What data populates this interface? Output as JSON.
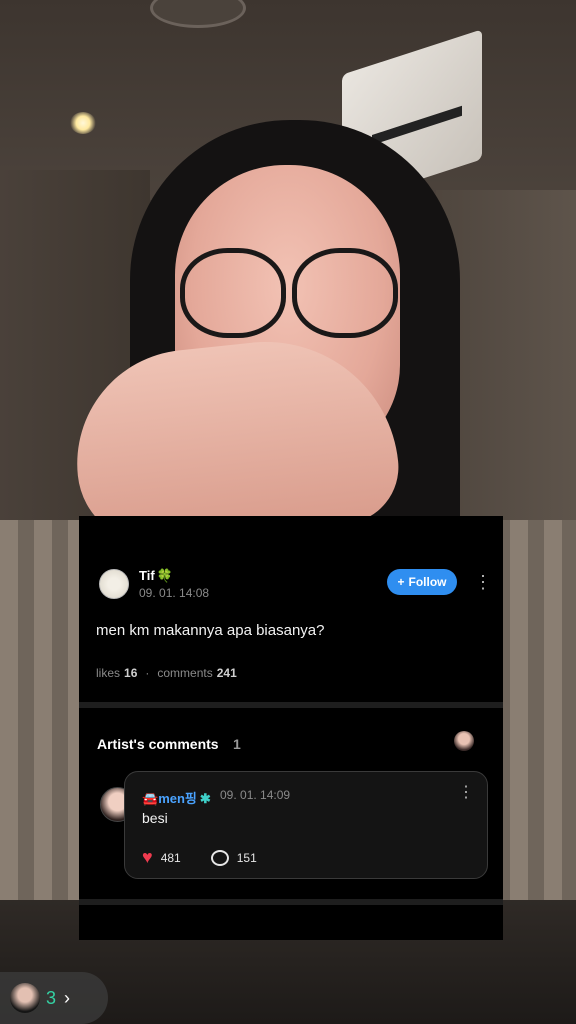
{
  "comment": {
    "author": "Tif",
    "author_emoji": "🍀",
    "date": "09. 01. 14:08",
    "follow_label": "Follow",
    "follow_icon": "+",
    "text": "men km makannya apa biasanya?",
    "likes_label": "likes",
    "likes_count": "16",
    "dot": "·",
    "comments_label": "comments",
    "comments_count": "241"
  },
  "artist_comments": {
    "title": "Artist's comments",
    "count": "1",
    "reply": {
      "name_prefix": "🚘",
      "name": "men핑",
      "verified_icon": "✱",
      "date": "09. 01. 14:09",
      "text": "besi",
      "like_count": "481",
      "reply_count": "151"
    }
  },
  "viewers": {
    "count": "3",
    "chevron": "›"
  },
  "icons": {
    "more": "⋮",
    "heart": "♥"
  },
  "colors": {
    "follow_button": "#2f8ef0",
    "artist_name": "#4aa3ff",
    "heart": "#ef3b4f",
    "viewer_count": "#34d1a3"
  }
}
